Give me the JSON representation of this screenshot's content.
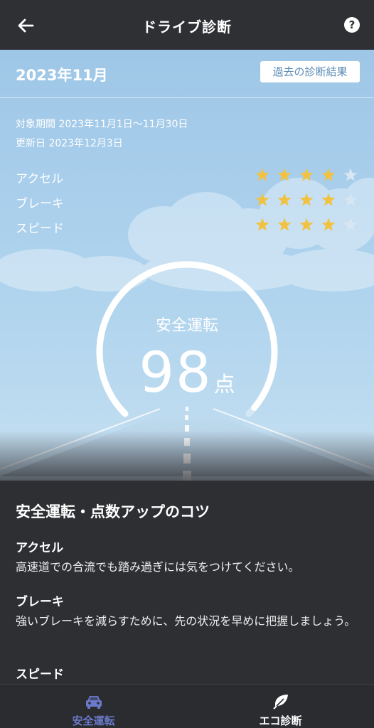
{
  "header": {
    "title": "ドライブ診断",
    "help_glyph": "?"
  },
  "hero": {
    "month": "2023年11月",
    "history_button": "過去の診断結果",
    "period": "対象期間 2023年11月1日〜11月30日",
    "updated": "更新日 2023年12月3日",
    "ratings": [
      {
        "label": "アクセル",
        "stars": 4,
        "max": 5
      },
      {
        "label": "ブレーキ",
        "stars": 4,
        "max": 5
      },
      {
        "label": "スピード",
        "stars": 4,
        "max": 5
      }
    ],
    "gauge": {
      "label": "安全運転",
      "score": "98",
      "unit": "点",
      "value": 98,
      "max": 100
    }
  },
  "tips": {
    "title": "安全運転・点数アップのコツ",
    "items": [
      {
        "heading": "アクセル",
        "body": "高速道での合流でも踏み過ぎには気をつけてください。"
      },
      {
        "heading": "ブレーキ",
        "body": "強いブレーキを減らすために、先の状況を早めに把握しましょう。"
      },
      {
        "heading": "スピード",
        "body": ""
      }
    ]
  },
  "bottom_nav": {
    "items": [
      {
        "label": "安全運転",
        "icon": "car-icon",
        "active": true
      },
      {
        "label": "エコ診断",
        "icon": "leaf-icon",
        "active": false
      }
    ]
  },
  "colors": {
    "star_on": "#f2c23e",
    "star_off": "#d6e6f3",
    "nav_active": "#6a79c8",
    "history_text": "#5a8cb6"
  }
}
